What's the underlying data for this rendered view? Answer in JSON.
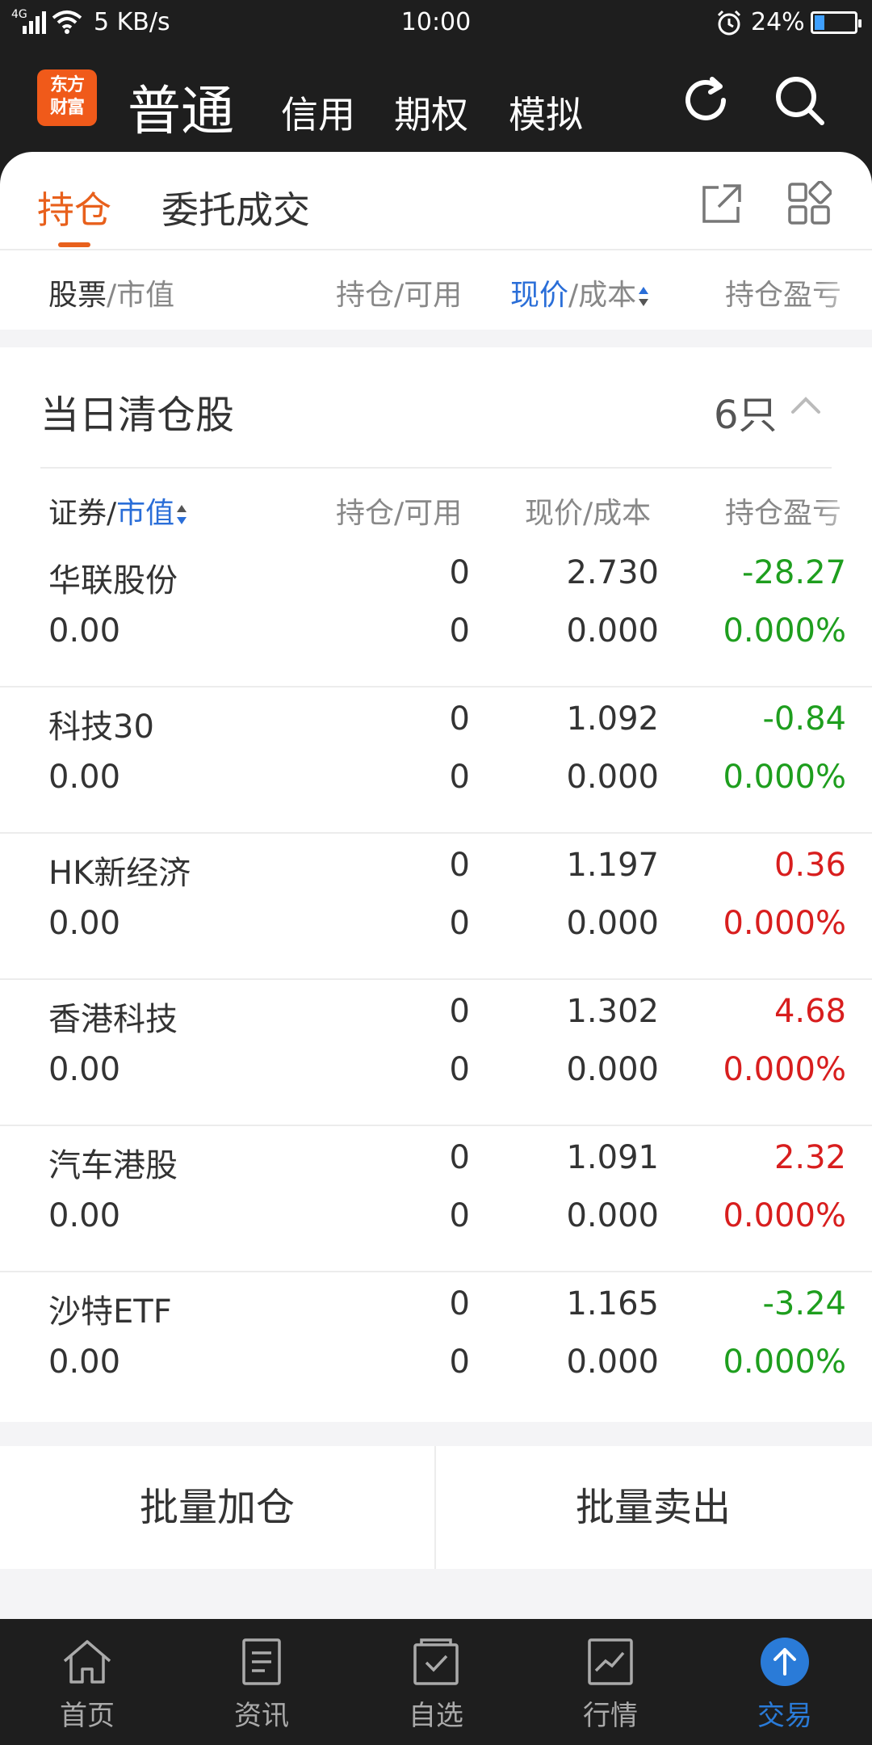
{
  "status_bar": {
    "network": "4G",
    "speed": "5 KB/s",
    "time": "10:00",
    "battery": "24%",
    "battery_level": 0.24
  },
  "header": {
    "logo_line1": "东方",
    "logo_line2": "财富",
    "tabs": [
      {
        "label": "普通",
        "active": true
      },
      {
        "label": "信用",
        "active": false
      },
      {
        "label": "期权",
        "active": false
      },
      {
        "label": "模拟",
        "active": false
      }
    ],
    "icons": [
      "refresh-icon",
      "search-icon"
    ]
  },
  "sub_tabs": [
    {
      "label": "持仓",
      "active": true
    },
    {
      "label": "委托成交",
      "active": false
    }
  ],
  "card_icons": [
    "share-icon",
    "grid-icon"
  ],
  "positions_header": {
    "c1_a": "股票",
    "c1_b": "/市值",
    "c2": "持仓/可用",
    "c3_a": "现价",
    "c3_b": "/成本",
    "c4": "持仓盈亏"
  },
  "cleared_section": {
    "title": "当日清仓股",
    "count": "6只",
    "header": {
      "c1_a": "证券/",
      "c1_b": "市值",
      "c2": "持仓/可用",
      "c3": "现价/成本",
      "c4": "持仓盈亏"
    },
    "rows": [
      {
        "name": "华联股份",
        "market_value": "0.00",
        "hold": "0",
        "available": "0",
        "price": "2.730",
        "cost": "0.000",
        "pl": "-28.27",
        "pl_pct": "0.000%",
        "trend": "down"
      },
      {
        "name": "科技30",
        "market_value": "0.00",
        "hold": "0",
        "available": "0",
        "price": "1.092",
        "cost": "0.000",
        "pl": "-0.84",
        "pl_pct": "0.000%",
        "trend": "down"
      },
      {
        "name": "HK新经济",
        "market_value": "0.00",
        "hold": "0",
        "available": "0",
        "price": "1.197",
        "cost": "0.000",
        "pl": "0.36",
        "pl_pct": "0.000%",
        "trend": "up"
      },
      {
        "name": "香港科技",
        "market_value": "0.00",
        "hold": "0",
        "available": "0",
        "price": "1.302",
        "cost": "0.000",
        "pl": "4.68",
        "pl_pct": "0.000%",
        "trend": "up"
      },
      {
        "name": "汽车港股",
        "market_value": "0.00",
        "hold": "0",
        "available": "0",
        "price": "1.091",
        "cost": "0.000",
        "pl": "2.32",
        "pl_pct": "0.000%",
        "trend": "up"
      },
      {
        "name": "沙特ETF",
        "market_value": "0.00",
        "hold": "0",
        "available": "0",
        "price": "1.165",
        "cost": "0.000",
        "pl": "-3.24",
        "pl_pct": "0.000%",
        "trend": "down"
      }
    ]
  },
  "batch": {
    "add": "批量加仓",
    "sell": "批量卖出"
  },
  "bottom_nav": [
    {
      "label": "首页",
      "icon": "home-icon",
      "active": false
    },
    {
      "label": "资讯",
      "icon": "news-icon",
      "active": false
    },
    {
      "label": "自选",
      "icon": "watchlist-icon",
      "active": false
    },
    {
      "label": "行情",
      "icon": "market-chart-icon",
      "active": false
    },
    {
      "label": "交易",
      "icon": "trade-arrow-icon",
      "active": true
    }
  ],
  "colors": {
    "accent_orange": "#e8601c",
    "link_blue": "#2a6ed8",
    "gain_red": "#d81e1e",
    "loss_green": "#1e9e1e",
    "dark_bar": "#1e1e1e"
  }
}
